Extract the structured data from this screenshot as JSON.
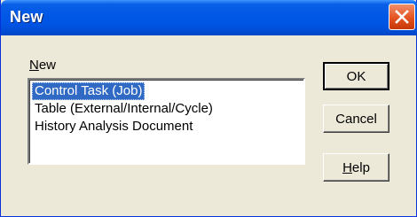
{
  "window": {
    "title": "New"
  },
  "group": {
    "label_mnemonic": "N",
    "label_rest": "ew"
  },
  "list": {
    "items": [
      {
        "label": "Control Task (Job)",
        "selected": true
      },
      {
        "label": "Table (External/Internal/Cycle)",
        "selected": false
      },
      {
        "label": "History Analysis Document",
        "selected": false
      }
    ]
  },
  "buttons": {
    "ok": "OK",
    "cancel": "Cancel",
    "help_mnemonic": "H",
    "help_rest": "elp"
  },
  "colors": {
    "title_bar": "#0054e3",
    "selection": "#316ac5",
    "close_button": "#e3531f",
    "dialog_background": "#ece9d8"
  },
  "icons": {
    "close": "close-x-icon"
  }
}
